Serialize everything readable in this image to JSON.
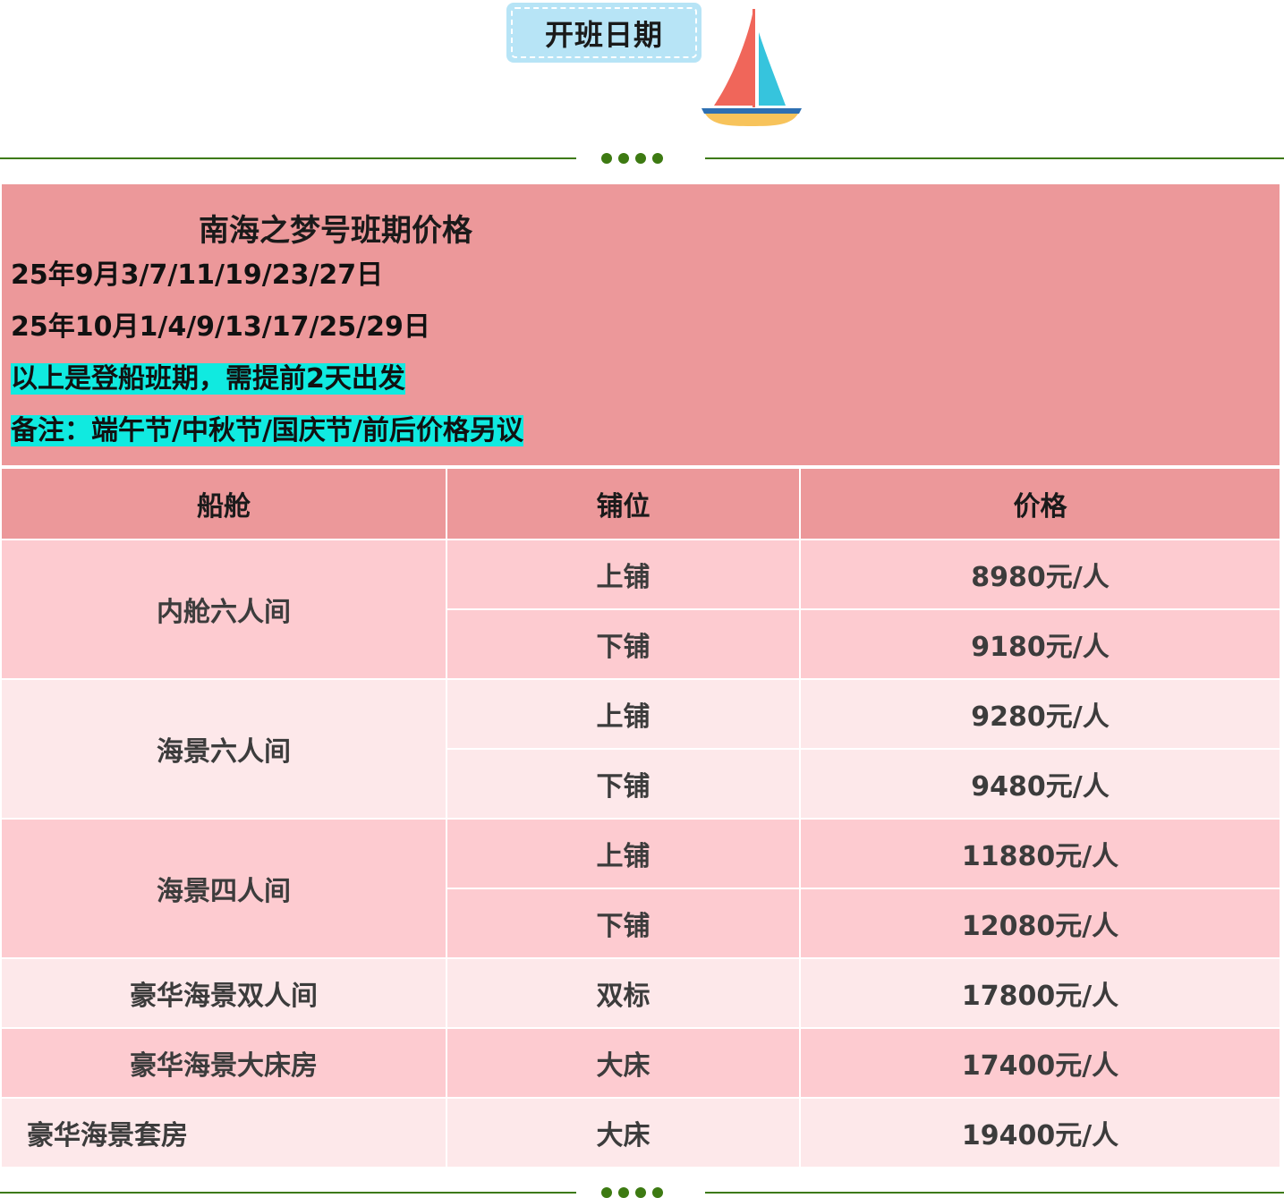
{
  "header": {
    "badge_label": "开班日期"
  },
  "panel": {
    "title": "南海之梦号班期价格",
    "dates_sep": "25年9月3/7/11/19/23/27日",
    "dates_oct": "25年10月1/4/9/13/17/25/29日",
    "note_departure": "以上是登船班期，需提前2天出发",
    "note_holiday": "备注：端午节/中秋节/国庆节/前后价格另议"
  },
  "table": {
    "headers": [
      "船舱",
      "铺位",
      "价格"
    ],
    "groups": [
      {
        "cabin": "内舱六人间",
        "rows": [
          {
            "berth": "上铺",
            "price": "8980元/人"
          },
          {
            "berth": "下铺",
            "price": "9180元/人"
          }
        ]
      },
      {
        "cabin": "海景六人间",
        "rows": [
          {
            "berth": "上铺",
            "price": "9280元/人"
          },
          {
            "berth": "下铺",
            "price": "9480元/人"
          }
        ]
      },
      {
        "cabin": "海景四人间",
        "rows": [
          {
            "berth": "上铺",
            "price": "11880元/人"
          },
          {
            "berth": "下铺",
            "price": "12080元/人"
          }
        ]
      },
      {
        "cabin": "豪华海景双人间",
        "rows": [
          {
            "berth": "双标",
            "price": "17800元/人"
          }
        ]
      },
      {
        "cabin": "豪华海景大床房",
        "rows": [
          {
            "berth": "大床",
            "price": "17400元/人"
          }
        ]
      },
      {
        "cabin": "豪华海景套房",
        "rows": [
          {
            "berth": "大床",
            "price": "19400元/人"
          }
        ]
      }
    ]
  },
  "colors": {
    "badge_bg": "#b7e4f6",
    "panel_bg": "#ec989a",
    "row_dark": "#fdcbd0",
    "row_light": "#fde8ea",
    "highlight": "#10eae0",
    "divider": "#3d7a12"
  },
  "icons": {
    "sailboat": "sailboat-icon"
  }
}
